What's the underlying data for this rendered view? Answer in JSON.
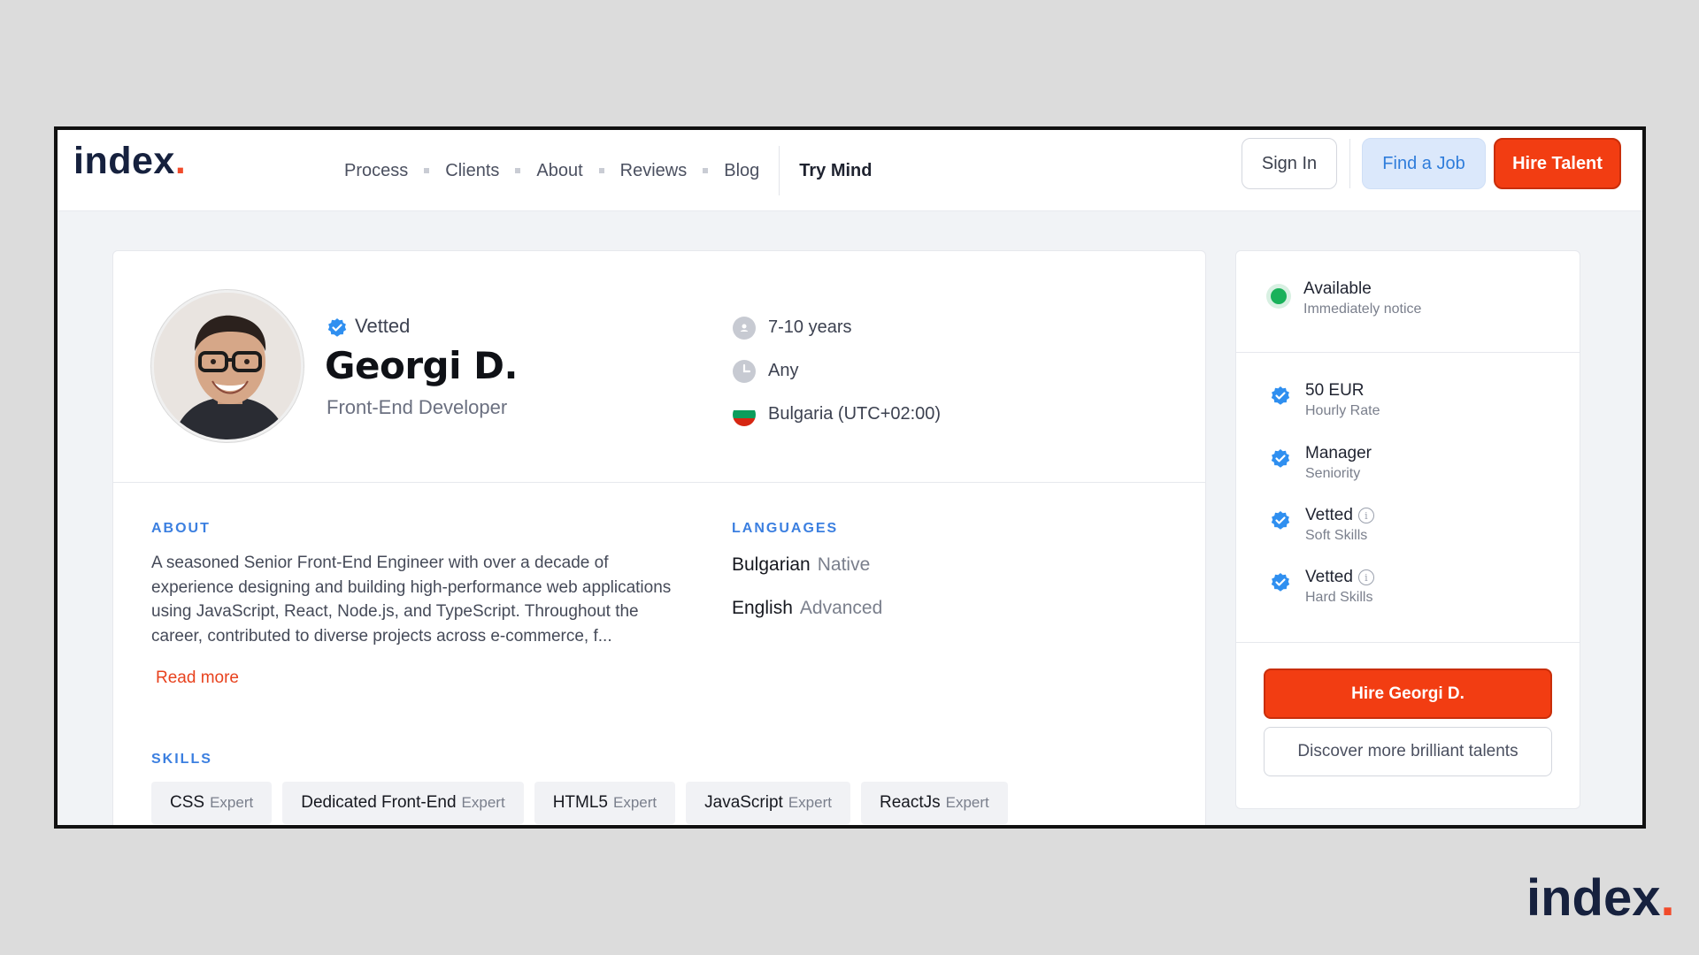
{
  "nav": {
    "logo_text": "index",
    "logo_dot": ".",
    "links": [
      "Process",
      "Clients",
      "About",
      "Reviews",
      "Blog"
    ],
    "try_mind": "Try Mind",
    "sign_in": "Sign In",
    "find_job": "Find a Job",
    "hire_talent": "Hire Talent"
  },
  "profile": {
    "vetted": "Vetted",
    "name": "Georgi D.",
    "role": "Front-End Developer",
    "experience": "7-10 years",
    "availability_type": "Any",
    "location": "Bulgaria (UTC+02:00)"
  },
  "about": {
    "label": "ABOUT",
    "text": "A seasoned Senior Front-End Engineer with over a decade of experience designing and building high-performance web applications using JavaScript, React, Node.js, and TypeScript. Throughout the career, contributed to diverse projects across e-commerce, f...",
    "read_more": "Read more"
  },
  "languages": {
    "label": "LANGUAGES",
    "items": [
      {
        "name": "Bulgarian",
        "level": "Native"
      },
      {
        "name": "English",
        "level": "Advanced"
      }
    ]
  },
  "skills": {
    "label": "SKILLS",
    "items": [
      {
        "name": "CSS",
        "level": "Expert"
      },
      {
        "name": "Dedicated Front-End",
        "level": "Expert"
      },
      {
        "name": "HTML5",
        "level": "Expert"
      },
      {
        "name": "JavaScript",
        "level": "Expert"
      },
      {
        "name": "ReactJs",
        "level": "Expert"
      }
    ]
  },
  "side": {
    "available": "Available",
    "notice": "Immediately notice",
    "rate": "50 EUR",
    "rate_label": "Hourly Rate",
    "seniority": "Manager",
    "seniority_label": "Seniority",
    "soft": "Vetted",
    "soft_label": "Soft Skills",
    "hard": "Vetted",
    "hard_label": "Hard Skills",
    "hire_button": "Hire Georgi D.",
    "discover_button": "Discover more brilliant talents"
  },
  "footer_logo": {
    "text": "index",
    "dot": "."
  },
  "colors": {
    "accent": "#f23d12",
    "blue": "#3b7fe0",
    "navy": "#16213e",
    "available": "#19b15a"
  }
}
